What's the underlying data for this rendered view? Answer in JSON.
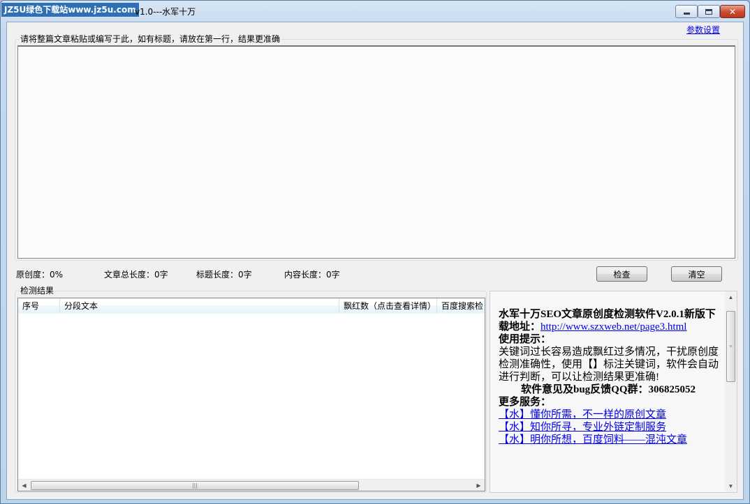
{
  "titlebar": {
    "watermark": "JZ5U绿色下载站www.jz5u.com",
    "title": "v1.0---水军十万"
  },
  "settings_link": "参数设置",
  "input_group": {
    "label": "请将整篇文章粘贴或编写于此，如有标题，请放在第一行，结果更准确",
    "value": ""
  },
  "stats": {
    "originality": "原创度：0%",
    "total_length": "文章总长度：0字",
    "title_length": "标题长度：0字",
    "content_length": "内容长度：0字"
  },
  "buttons": {
    "check": "检查",
    "clear": "清空"
  },
  "results": {
    "label": "检测结果",
    "columns": [
      "序号",
      "分段文本",
      "飘红数（点击查看详情）",
      "百度搜索检"
    ]
  },
  "info": {
    "headline": "水军十万SEO文章原创度检测软件V2.0.1新版下载地址：",
    "url": "http://www.szxweb.net/page3.html",
    "tip_title": "使用提示：",
    "tip_body": "关键词过长容易造成飘红过多情况，干扰原创度检测准确性，使用【】标注关键词，软件会自动进行判断，可以让检测结果更准确!",
    "feedback": "软件意见及bug反馈QQ群：306825052",
    "more_title": "更多服务：",
    "services": [
      "【水】懂你所需，不一样的原创文章",
      "【水】知你所寻，专业外链定制服务",
      "【水】明你所想，百度饲料——混沌文章"
    ]
  }
}
